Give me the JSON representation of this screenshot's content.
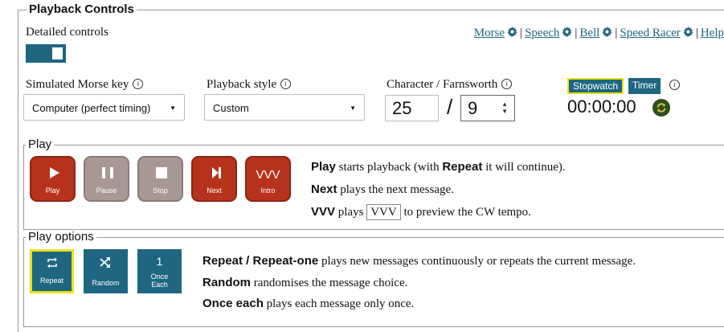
{
  "section_title": "Playback Controls",
  "detailed_controls_label": "Detailed controls",
  "links": [
    {
      "label": "Morse"
    },
    {
      "label": "Speech"
    },
    {
      "label": "Bell"
    },
    {
      "label": "Speed Racer"
    },
    {
      "label": "Help"
    }
  ],
  "morse_key": {
    "label": "Simulated Morse key",
    "value": "Computer (perfect timing)"
  },
  "playback_style": {
    "label": "Playback style",
    "value": "Custom"
  },
  "speed": {
    "label": "Character / Farnsworth",
    "character": "25",
    "separator": "/",
    "farnsworth": "9"
  },
  "timer": {
    "stopwatch_label": "Stopwatch",
    "timer_label": "Timer",
    "display": "00:00:00"
  },
  "play": {
    "legend": "Play",
    "buttons": {
      "play": "Play",
      "pause": "Pause",
      "stop": "Stop",
      "next": "Next",
      "intro_glyph": "VVV",
      "intro": "Intro"
    },
    "desc": {
      "play_bold": "Play",
      "play_mid": " starts playback (with ",
      "repeat_bold": "Repeat",
      "play_end": " it will continue).",
      "next_bold": "Next",
      "next_rest": " plays the next message.",
      "vvv_bold": "VVV",
      "vvv_mid": " plays ",
      "vvv_box": "VVV",
      "vvv_end": " to preview the CW tempo."
    }
  },
  "play_options": {
    "legend": "Play options",
    "buttons": {
      "repeat": "Repeat",
      "random": "Random",
      "once_glyph": "1",
      "once_line1": "Once",
      "once_line2": "Each"
    },
    "desc": {
      "repeat_bold": "Repeat / Repeat-one",
      "repeat_rest": " plays new messages continuously or repeats the current message.",
      "random_bold": "Random",
      "random_rest": " randomises the message choice.",
      "once_bold": "Once each",
      "once_rest": " plays each message only once."
    }
  },
  "colors": {
    "accent": "#1f6680",
    "play_red": "#b7321c",
    "disabled_grey": "#a79893",
    "highlight": "#e8e21a"
  }
}
